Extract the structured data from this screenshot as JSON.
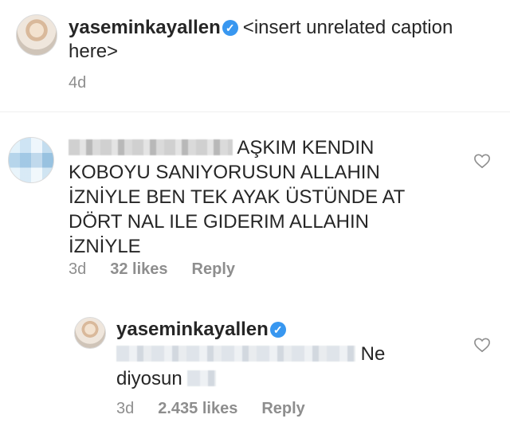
{
  "post": {
    "username": "yaseminkayallen",
    "caption": "<insert unrelated caption here>",
    "time": "4d"
  },
  "comment": {
    "text": "AŞKIM KENDIN KOBOYU SANIYORUSUN ALLAHIN İZNİYLE BEN TEK AYAK ÜSTÜNDE AT DÖRT NAL ILE GIDERIM ALLAHIN İZNİYLE",
    "time": "3d",
    "likes": "32 likes",
    "reply_label": "Reply"
  },
  "reply": {
    "username": "yaseminkayallen",
    "text": "Ne diyosun",
    "time": "3d",
    "likes": "2.435 likes",
    "reply_label": "Reply"
  },
  "icons": {
    "verified": "verified-badge-icon",
    "like": "heart-outline-icon"
  },
  "colors": {
    "verified": "#3897f0",
    "meta": "#8e8e8e",
    "text": "#262626"
  }
}
